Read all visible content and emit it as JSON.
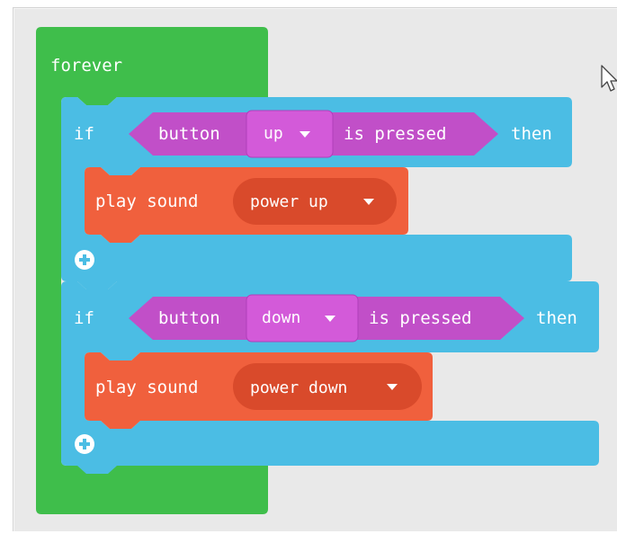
{
  "forever_label": "forever",
  "if_blocks": [
    {
      "if_label": "if",
      "condition": {
        "button_label": "button",
        "button_value": "up",
        "is_pressed_label": "is pressed"
      },
      "then_label": "then",
      "action": {
        "play_label": "play sound",
        "sound_value": "power up"
      }
    },
    {
      "if_label": "if",
      "condition": {
        "button_label": "button",
        "button_value": "down",
        "is_pressed_label": "is pressed"
      },
      "then_label": "then",
      "action": {
        "play_label": "play sound",
        "sound_value": "power down"
      }
    }
  ],
  "icons": {
    "add": "plus-circle-icon",
    "dropdown": "triangle-down-icon",
    "cursor": "mouse-pointer-icon"
  },
  "colors": {
    "loop_green": "#3fbe4b",
    "logic_blue": "#4bbde4",
    "input_magenta": "#c14fc8",
    "sound_orange": "#f0603d"
  }
}
